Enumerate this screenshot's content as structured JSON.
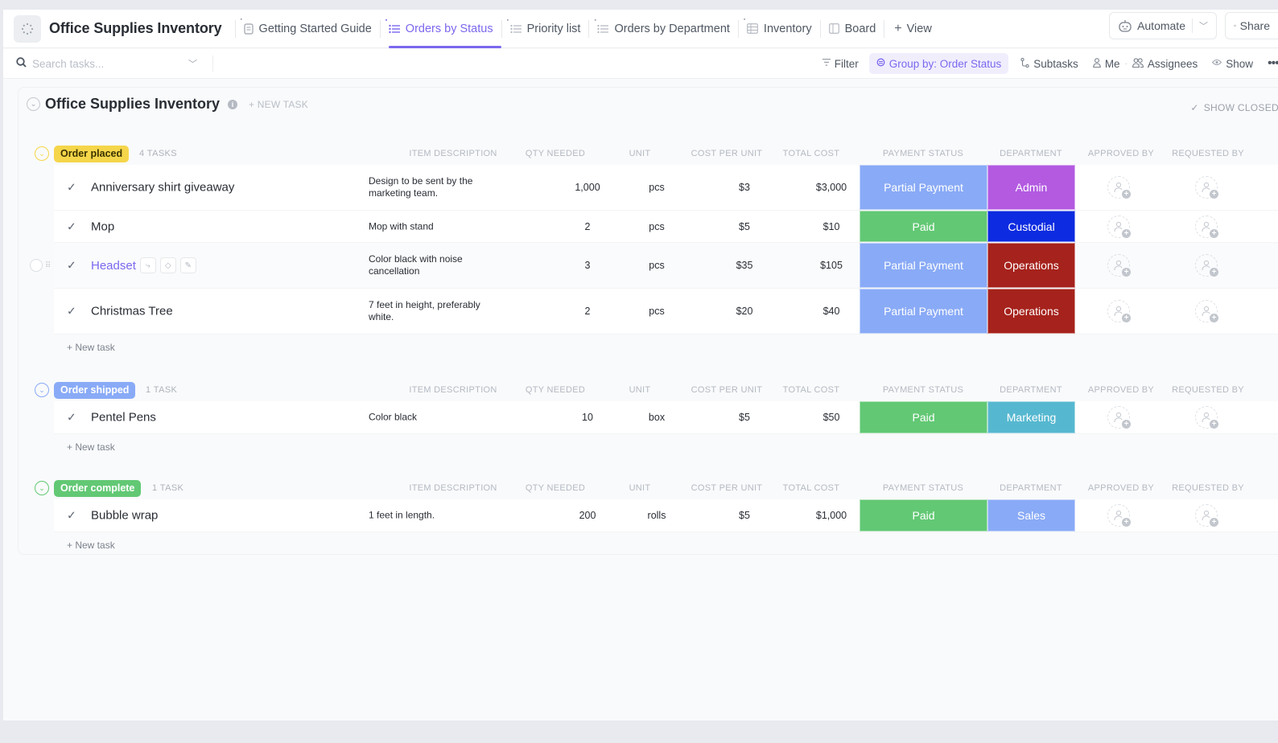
{
  "topbar": {
    "space_title": "Office Supplies Inventory",
    "tabs": [
      {
        "label": "Getting Started Guide",
        "icon": "doc-icon",
        "active": false
      },
      {
        "label": "Orders by Status",
        "icon": "list-icon",
        "active": true
      },
      {
        "label": "Priority list",
        "icon": "list-icon",
        "active": false
      },
      {
        "label": "Orders by Department",
        "icon": "list-icon",
        "active": false
      },
      {
        "label": "Inventory",
        "icon": "table-icon",
        "active": false
      },
      {
        "label": "Board",
        "icon": "board-icon",
        "active": false
      }
    ],
    "add_view_label": "View",
    "automate_label": "Automate",
    "share_label": "Share"
  },
  "toolbar": {
    "search_placeholder": "Search tasks...",
    "filter_label": "Filter",
    "group_by_label": "Group by: Order Status",
    "subtasks_label": "Subtasks",
    "me_label": "Me",
    "assignees_label": "Assignees",
    "show_label": "Show"
  },
  "list": {
    "title": "Office Supplies Inventory",
    "new_task_label": "+ NEW TASK",
    "show_closed_label": "SHOW CLOSED",
    "columns": {
      "item_description": "ITEM DESCRIPTION",
      "qty_needed": "QTY NEEDED",
      "unit": "UNIT",
      "cost_per_unit": "COST PER UNIT",
      "total_cost": "TOTAL COST",
      "payment_status": "PAYMENT STATUS",
      "department": "DEPARTMENT",
      "approved_by": "APPROVED BY",
      "requested_by": "REQUESTED BY"
    },
    "add_task_label": "+ New task",
    "groups": [
      {
        "status": "Order placed",
        "count_label": "4 TASKS",
        "color": "#f5d64a",
        "text_color": "#3a3200",
        "tasks": [
          {
            "name": "Anniversary shirt giveaway",
            "description": "Design to be sent by the marketing team.",
            "qty": "1,000",
            "unit": "pcs",
            "cost_per_unit": "$3",
            "total_cost": "$3,000",
            "payment_status": "Partial Payment",
            "payment_color": "#89aaf6",
            "department": "Admin",
            "department_color": "#b35ae1"
          },
          {
            "name": "Mop",
            "description": "Mop with stand",
            "qty": "2",
            "unit": "pcs",
            "cost_per_unit": "$5",
            "total_cost": "$10",
            "payment_status": "Paid",
            "payment_color": "#62c874",
            "department": "Custodial",
            "department_color": "#0d2be0"
          },
          {
            "name": "Headset",
            "description": "Color black with noise cancellation",
            "qty": "3",
            "unit": "pcs",
            "cost_per_unit": "$35",
            "total_cost": "$105",
            "payment_status": "Partial Payment",
            "payment_color": "#89aaf6",
            "department": "Operations",
            "department_color": "#a6221c"
          },
          {
            "name": "Christmas Tree",
            "description": "7 feet in height, preferably white.",
            "qty": "2",
            "unit": "pcs",
            "cost_per_unit": "$20",
            "total_cost": "$40",
            "payment_status": "Partial Payment",
            "payment_color": "#89aaf6",
            "department": "Operations",
            "department_color": "#a6221c"
          }
        ]
      },
      {
        "status": "Order shipped",
        "count_label": "1 TASK",
        "color": "#89aaf6",
        "text_color": "#ffffff",
        "tasks": [
          {
            "name": "Pentel Pens",
            "description": "Color black",
            "qty": "10",
            "unit": "box",
            "cost_per_unit": "$5",
            "total_cost": "$50",
            "payment_status": "Paid",
            "payment_color": "#62c874",
            "department": "Marketing",
            "department_color": "#56b8d0"
          }
        ]
      },
      {
        "status": "Order complete",
        "count_label": "1 TASK",
        "color": "#62c874",
        "text_color": "#ffffff",
        "tasks": [
          {
            "name": "Bubble wrap",
            "description": "1 feet in length.",
            "qty": "200",
            "unit": "rolls",
            "cost_per_unit": "$5",
            "total_cost": "$1,000",
            "payment_status": "Paid",
            "payment_color": "#62c874",
            "department": "Sales",
            "department_color": "#89aaf6"
          }
        ]
      }
    ]
  },
  "colors": {
    "accent": "#7b68ee"
  }
}
